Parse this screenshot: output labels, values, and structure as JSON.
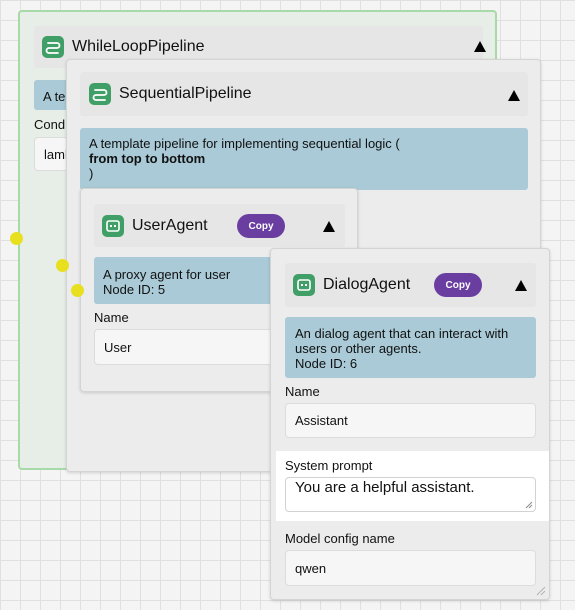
{
  "while_loop": {
    "title": "WhileLoopPipeline",
    "desc_fragment": "A te",
    "cond_label": "Cond",
    "cond_value": "laml"
  },
  "sequential": {
    "title": "SequentialPipeline",
    "desc_line1": "A template pipeline for implementing sequential logic (",
    "desc_bold": "from top to bottom",
    "desc_close": ")"
  },
  "user_agent": {
    "title": "UserAgent",
    "copy_label": "Copy",
    "desc_line1": "A proxy agent for user",
    "desc_line2": "Node ID: 5",
    "name_label": "Name",
    "name_value": "User"
  },
  "dialog_agent": {
    "title": "DialogAgent",
    "copy_label": "Copy",
    "desc_line1": "An dialog agent that can interact with",
    "desc_line2": "users or other agents.",
    "desc_line3": "Node ID: 6",
    "name_label": "Name",
    "name_value": "Assistant",
    "sys_prompt_label": "System prompt",
    "sys_prompt_value": "You are a helpful assistant.",
    "model_label": "Model config name",
    "model_value": "qwen"
  },
  "colors": {
    "pipeline_icon": "#3f9f67",
    "description_bg": "#a9cad6",
    "copy_button": "#6a3ea1",
    "handle": "#e8e01e",
    "while_border": "#a8d9a8"
  }
}
